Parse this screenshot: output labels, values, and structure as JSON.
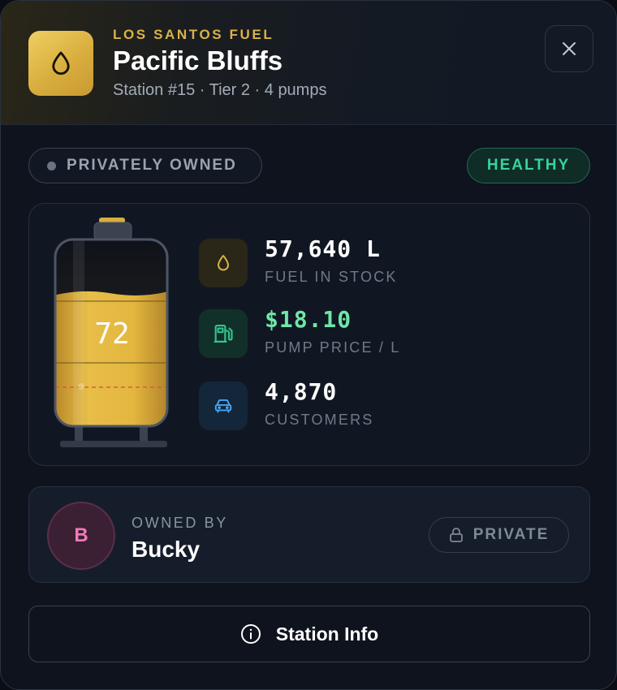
{
  "header": {
    "brand": "LOS SANTOS FUEL",
    "title": "Pacific Bluffs",
    "subtitle": "Station #15 · Tier 2 · 4 pumps",
    "brand_icon": "droplet-icon",
    "close_icon": "close-icon"
  },
  "status": {
    "ownership": "PRIVATELY OWNED",
    "health": "HEALTHY"
  },
  "tank": {
    "level_label": "72",
    "fill_percent": 72,
    "fill_color": "#e3b63f"
  },
  "stats": [
    {
      "icon": "droplet-icon",
      "value": "57,640 L",
      "label": "FUEL IN STOCK"
    },
    {
      "icon": "fuel-pump-icon",
      "value": "$18.10",
      "label": "PUMP PRICE / L"
    },
    {
      "icon": "car-icon",
      "value": "4,870",
      "label": "CUSTOMERS"
    }
  ],
  "owner": {
    "avatar_initial": "B",
    "label": "OWNED BY",
    "name": "Bucky",
    "privacy": "PRIVATE",
    "privacy_icon": "lock-icon"
  },
  "actions": {
    "info_label": "Station Info",
    "info_icon": "info-icon"
  },
  "colors": {
    "accent_gold": "#d9b249",
    "healthy_green": "#35d49c",
    "price_green": "#6ee7a8",
    "customers_blue": "#4aa3f0",
    "avatar_pink": "#f07ab8"
  }
}
